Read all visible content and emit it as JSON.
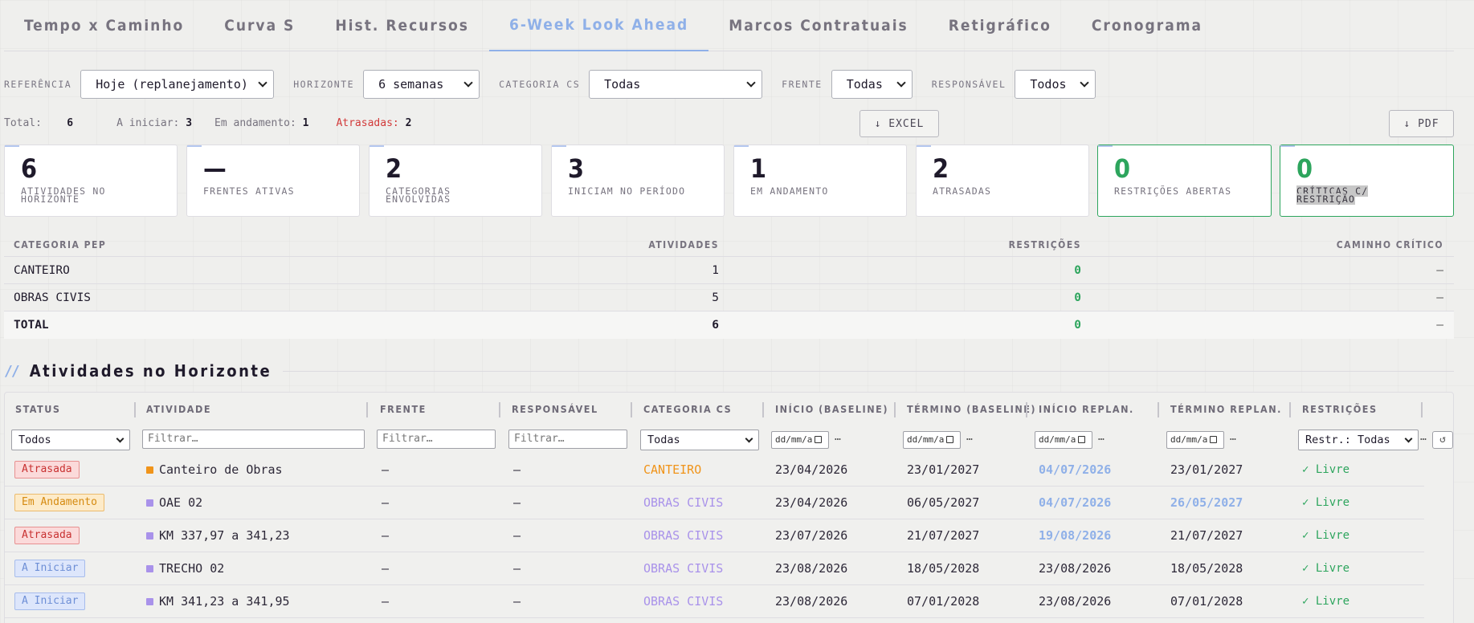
{
  "tabs": [
    {
      "label": "Tempo x Caminho"
    },
    {
      "label": "Curva S"
    },
    {
      "label": "Hist. Recursos"
    },
    {
      "label": "6-Week Look Ahead"
    },
    {
      "label": "Marcos Contratuais"
    },
    {
      "label": "Retigráfico"
    },
    {
      "label": "Cronograma"
    }
  ],
  "filters": {
    "referencia_label": "REFERÊNCIA",
    "referencia_value": "Hoje (replanejamento)",
    "horizonte_label": "HORIZONTE",
    "horizonte_value": "6 semanas",
    "categoria_label": "CATEGORIA CS",
    "categoria_value": "Todas",
    "frente_label": "FRENTE",
    "frente_value": "Todas",
    "responsavel_label": "RESPONSÁVEL",
    "responsavel_value": "Todos"
  },
  "stats": {
    "total_label": "Total:",
    "total_value": "6",
    "iniciar_label": "A iniciar:",
    "iniciar_value": "3",
    "andamento_label": "Em andamento:",
    "andamento_value": "1",
    "atrasadas_label": "Atrasadas:",
    "atrasadas_value": "2"
  },
  "buttons": {
    "excel": "↓ EXCEL",
    "pdf": "↓ PDF"
  },
  "cards": [
    {
      "value": "6",
      "label": "ATIVIDADES NO HORIZONTE"
    },
    {
      "value": "—",
      "label": "FRENTES ATIVAS"
    },
    {
      "value": "2",
      "label": "CATEGORIAS ENVOLVIDAS"
    },
    {
      "value": "3",
      "label": "INICIAM NO PERÍODO"
    },
    {
      "value": "1",
      "label": "EM ANDAMENTO"
    },
    {
      "value": "2",
      "label": "ATRASADAS"
    },
    {
      "value": "0",
      "label": "RESTRIÇÕES ABERTAS"
    },
    {
      "value": "0",
      "label": "CRÍTICAS C/ RESTRIÇÃO"
    }
  ],
  "summary": {
    "headers": {
      "categoria": "CATEGORIA PEP",
      "atividades": "ATIVIDADES",
      "restricoes": "RESTRIÇÕES",
      "caminho": "CAMINHO CRÍTICO"
    },
    "rows": [
      {
        "categoria": "CANTEIRO",
        "atividades": "1",
        "restricoes": "0",
        "caminho": "—"
      },
      {
        "categoria": "OBRAS CIVIS",
        "atividades": "5",
        "restricoes": "0",
        "caminho": "—"
      }
    ],
    "total": {
      "categoria": "TOTAL",
      "atividades": "6",
      "restricoes": "0",
      "caminho": "—"
    }
  },
  "section": {
    "slashes": "//",
    "title": "Atividades no Horizonte"
  },
  "grid": {
    "headers": {
      "status": "STATUS",
      "atividade": "ATIVIDADE",
      "frente": "FRENTE",
      "responsavel": "RESPONSÁVEL",
      "categoria": "CATEGORIA CS",
      "inicio_base": "INÍCIO (BASELINE)",
      "termino_base": "TÉRMINO (BASELINE)",
      "inicio_replan": "INÍCIO REPLAN.",
      "termino_replan": "TÉRMINO REPLAN.",
      "restricoes": "RESTRIÇÕES"
    },
    "filters": {
      "status": "Todos",
      "atividade_ph": "Filtrar…",
      "frente_ph": "Filtrar…",
      "responsavel_ph": "Filtrar…",
      "categoria": "Todas",
      "date_ph": "dd/mm/a",
      "dots": "…",
      "restricoes": "Restr.: Todas",
      "reset": "↺",
      "more": "…"
    },
    "rows": [
      {
        "status": "Atrasada",
        "atividade": "Canteiro de Obras",
        "frente": "—",
        "responsavel": "—",
        "categoria": "CANTEIRO",
        "inicio_base": "23/04/2026",
        "termino_base": "23/01/2027",
        "inicio_replan": "04/07/2026",
        "termino_replan": "23/01/2027",
        "restricoes": "✓ Livre"
      },
      {
        "status": "Em Andamento",
        "atividade": "OAE 02",
        "frente": "—",
        "responsavel": "—",
        "categoria": "OBRAS CIVIS",
        "inicio_base": "23/04/2026",
        "termino_base": "06/05/2027",
        "inicio_replan": "04/07/2026",
        "termino_replan": "26/05/2027",
        "restricoes": "✓ Livre"
      },
      {
        "status": "Atrasada",
        "atividade": "KM 337,97 a 341,23",
        "frente": "—",
        "responsavel": "—",
        "categoria": "OBRAS CIVIS",
        "inicio_base": "23/07/2026",
        "termino_base": "21/07/2027",
        "inicio_replan": "19/08/2026",
        "termino_replan": "21/07/2027",
        "restricoes": "✓ Livre"
      },
      {
        "status": "A Iniciar",
        "atividade": "TRECHO 02",
        "frente": "—",
        "responsavel": "—",
        "categoria": "OBRAS CIVIS",
        "inicio_base": "23/08/2026",
        "termino_base": "18/05/2028",
        "inicio_replan": "23/08/2026",
        "termino_replan": "18/05/2028",
        "restricoes": "✓ Livre"
      },
      {
        "status": "A Iniciar",
        "atividade": "KM 341,23 a 341,95",
        "frente": "—",
        "responsavel": "—",
        "categoria": "OBRAS CIVIS",
        "inicio_base": "23/08/2026",
        "termino_base": "07/01/2028",
        "inicio_replan": "23/08/2026",
        "termino_replan": "07/01/2028",
        "restricoes": "✓ Livre"
      }
    ]
  },
  "colors": {
    "accent": "#8fb0e8",
    "green": "#2da55d",
    "late": "#c83232",
    "progress": "#d58a10",
    "canteiro": "#f0941a",
    "obras_civis": "#a992ea"
  }
}
